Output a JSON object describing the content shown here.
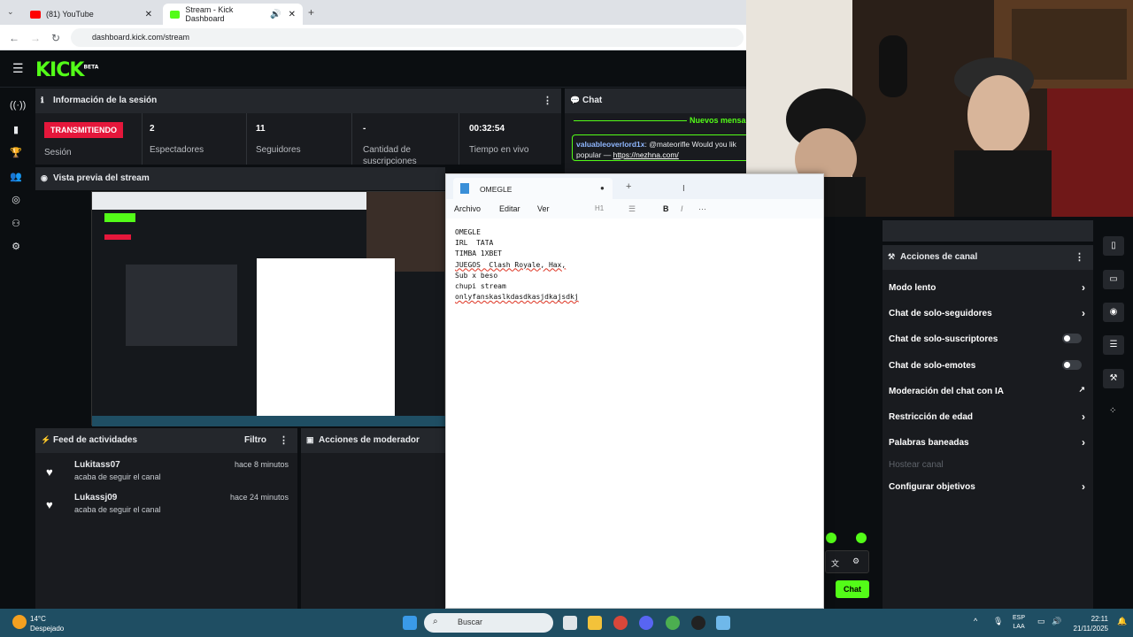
{
  "browser": {
    "tabs": [
      {
        "label": "(81) YouTube"
      },
      {
        "label": "Stream - Kick Dashboard"
      }
    ],
    "url": "dashboard.kick.com/stream"
  },
  "kick": {
    "logo": "KICK",
    "logo_tag": "BETA",
    "session": {
      "title": "Información de la sesión",
      "live_badge": "TRANSMITIENDO",
      "session_label": "Sesión",
      "stats": [
        {
          "value": "2",
          "label": "Espectadores"
        },
        {
          "value": "11",
          "label": "Seguidores"
        },
        {
          "value": "-",
          "label": "Cantidad de suscripciones"
        },
        {
          "value": "00:32:54",
          "label": "Tiempo en vivo"
        }
      ]
    },
    "preview": {
      "title": "Vista previa del stream"
    },
    "feed": {
      "title": "Feed de actividades",
      "filter": "Filtro",
      "items": [
        {
          "name": "Lukitass07",
          "action": "acaba de seguir el canal",
          "time": "hace 8 minutos"
        },
        {
          "name": "Lukassj09",
          "action": "acaba de seguir el canal",
          "time": "hace 24 minutos"
        }
      ]
    },
    "mod_actions": {
      "title": "Acciones de moderador"
    },
    "chat": {
      "title": "Chat",
      "new_messages": "Nuevos mensa",
      "message_user": "valuableoverlord1x",
      "message_text": ": @mateorifle Would you lik popular —",
      "message_link": "https://nezhna.com/",
      "button": "Chat"
    },
    "channel_actions": {
      "title": "Acciones de canal",
      "items": [
        {
          "label": "Modo lento",
          "control": "chevron"
        },
        {
          "label": "Chat de solo-seguidores",
          "control": "chevron"
        },
        {
          "label": "Chat de solo-suscriptores",
          "control": "toggle"
        },
        {
          "label": "Chat de solo-emotes",
          "control": "toggle"
        },
        {
          "label": "Moderación del chat con IA",
          "control": "external"
        },
        {
          "label": "Restricción de edad",
          "control": "chevron"
        },
        {
          "label": "Palabras baneadas",
          "control": "chevron"
        },
        {
          "label": "Hostear canal",
          "control": "none"
        },
        {
          "label": "Configurar objetivos",
          "control": "chevron"
        }
      ]
    }
  },
  "notepad": {
    "tab_title": "OMEGLE",
    "menu": [
      "Archivo",
      "Editar",
      "Ver"
    ],
    "heading": "H1",
    "lines": [
      "OMEGLE",
      "IRL  TATA",
      "TIMBA 1XBET",
      "JUEGOS  Clash Royale, Hax,",
      "Sub x beso",
      "chupi stream",
      "onlyfanskaslkdasdkasjdkajsdkj"
    ]
  },
  "taskbar": {
    "weather_temp": "14°C",
    "weather_desc": "Despejado",
    "search": "Buscar",
    "lang1": "ESP",
    "lang2": "LAA",
    "time": "22:11",
    "date": "21/11/2025"
  },
  "colors": {
    "kick_green": "#53fc18",
    "live_red": "#e5173b",
    "panel": "#191b1f",
    "panel_header": "#24272c",
    "taskbar": "#1f4e63"
  }
}
